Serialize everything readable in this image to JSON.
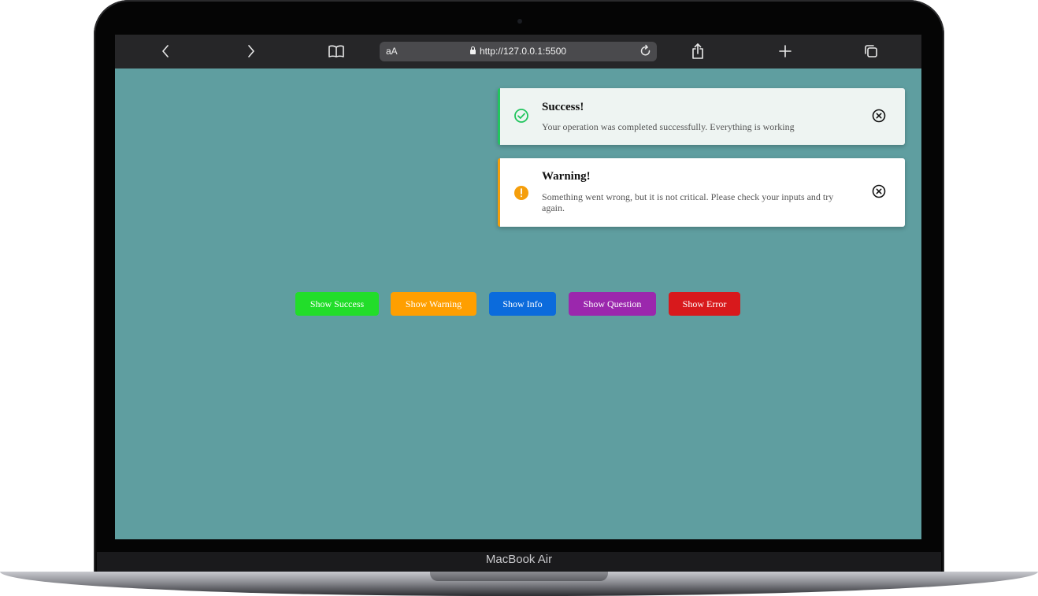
{
  "browser": {
    "reader_label": "aA",
    "url": "http://127.0.0.1:5500"
  },
  "device": {
    "label": "MacBook Air"
  },
  "toasts": [
    {
      "type": "success",
      "icon": "check-circle-icon",
      "title": "Success!",
      "message": "Your operation was completed successfully. Everything is working",
      "accent": "#22c55e"
    },
    {
      "type": "warning",
      "icon": "exclamation-circle-icon",
      "title": "Warning!",
      "message": "Something went wrong, but it is not critical. Please check your inputs and try again.",
      "accent": "#f59e0b"
    }
  ],
  "buttons": {
    "success": "Show Success",
    "warning": "Show Warning",
    "info": "Show Info",
    "question": "Show Question",
    "error": "Show Error"
  },
  "colors": {
    "page_background": "#5f9ea0",
    "success": "#22dd2a",
    "warning": "#ff9f00",
    "info": "#0b6bdc",
    "question": "#9b27ad",
    "error": "#d8191c"
  }
}
